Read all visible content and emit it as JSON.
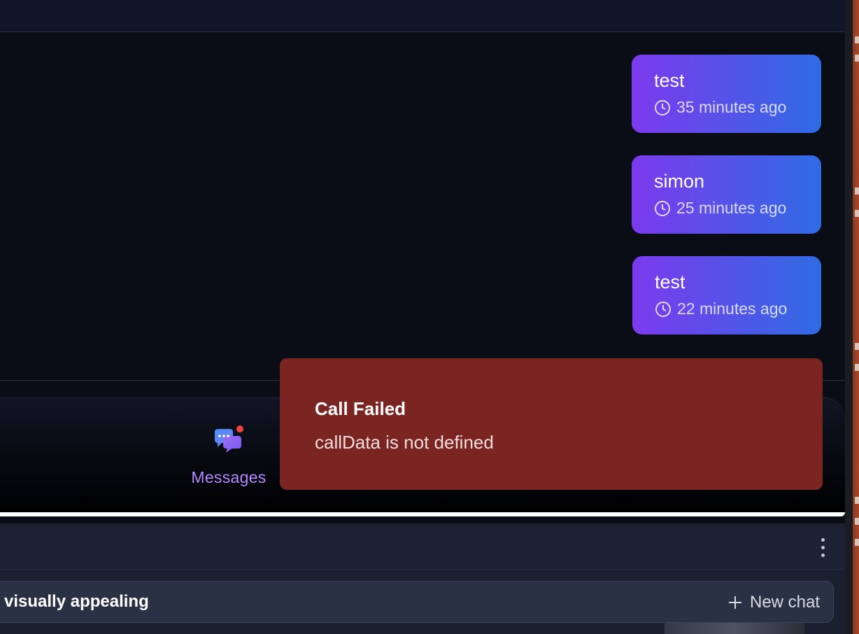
{
  "chat": {
    "messages": [
      {
        "text": "test",
        "time": "35 minutes ago"
      },
      {
        "text": "simon",
        "time": "25 minutes ago"
      },
      {
        "text": "test",
        "time": "22 minutes ago"
      }
    ]
  },
  "nav": {
    "messages_label": "Messages"
  },
  "toast": {
    "title": "Call Failed",
    "description": "callData is not defined",
    "color": "#7b2523"
  },
  "lower": {
    "input_text": "visually appealing",
    "new_chat_label": "New chat"
  },
  "colors": {
    "bubble_start": "#7c3aed",
    "bubble_end": "#2f6be3",
    "nav_label": "#b388ff",
    "background": "#0a0d15"
  }
}
